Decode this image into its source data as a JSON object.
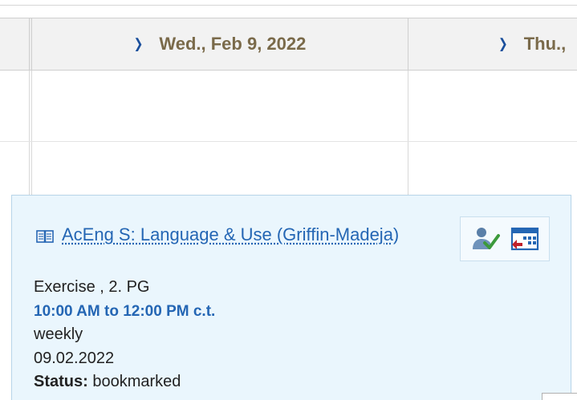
{
  "calendar": {
    "days": [
      {
        "label": "Wed., Feb 9, 2022"
      },
      {
        "label": "Thu.,"
      }
    ]
  },
  "event": {
    "title": "AcEng S: Language & Use (Griffin-Madeja)",
    "type_group": "Exercise , 2. PG",
    "time": "10:00 AM to 12:00 PM c.t.",
    "frequency": "weekly",
    "date": "09.02.2022",
    "status_label": "Status:",
    "status_value": "bookmarked"
  },
  "icons": {
    "course": "book-icon",
    "register": "person-check-icon",
    "schedule": "calendar-remove-icon"
  },
  "colors": {
    "link": "#2466b4",
    "day_label": "#7a6a4a",
    "chevron": "#1a4f9c",
    "card_bg": "#eaf6fd",
    "header_bg": "#f2f2f2"
  }
}
